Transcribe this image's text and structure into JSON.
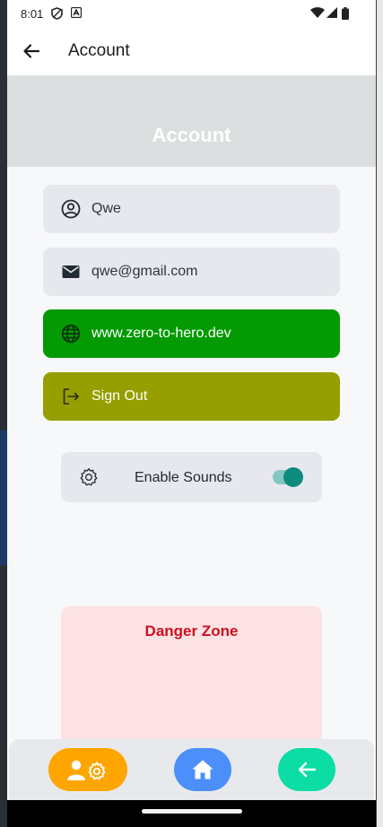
{
  "status_bar": {
    "time": "8:01"
  },
  "app_bar": {
    "title": "Account"
  },
  "banner": {
    "title": "Account"
  },
  "profile": {
    "name": "Qwe",
    "email": "qwe@gmail.com",
    "website": "www.zero-to-hero.dev",
    "sign_out_label": "Sign Out"
  },
  "settings": {
    "enable_sounds_label": "Enable Sounds",
    "enable_sounds_on": true
  },
  "danger_zone": {
    "title": "Danger Zone"
  },
  "colors": {
    "website_button": "#039a03",
    "sign_out_button": "#959f00",
    "toggle_active": "#0d8b7d",
    "danger_title": "#cc1020",
    "nav_profile": "#ffa500",
    "nav_home": "#4c8ffa",
    "nav_back": "#0bdda4"
  },
  "bottom_nav": [
    {
      "icon": "profile-settings-icon"
    },
    {
      "icon": "home-icon"
    },
    {
      "icon": "arrow-left-icon"
    }
  ]
}
